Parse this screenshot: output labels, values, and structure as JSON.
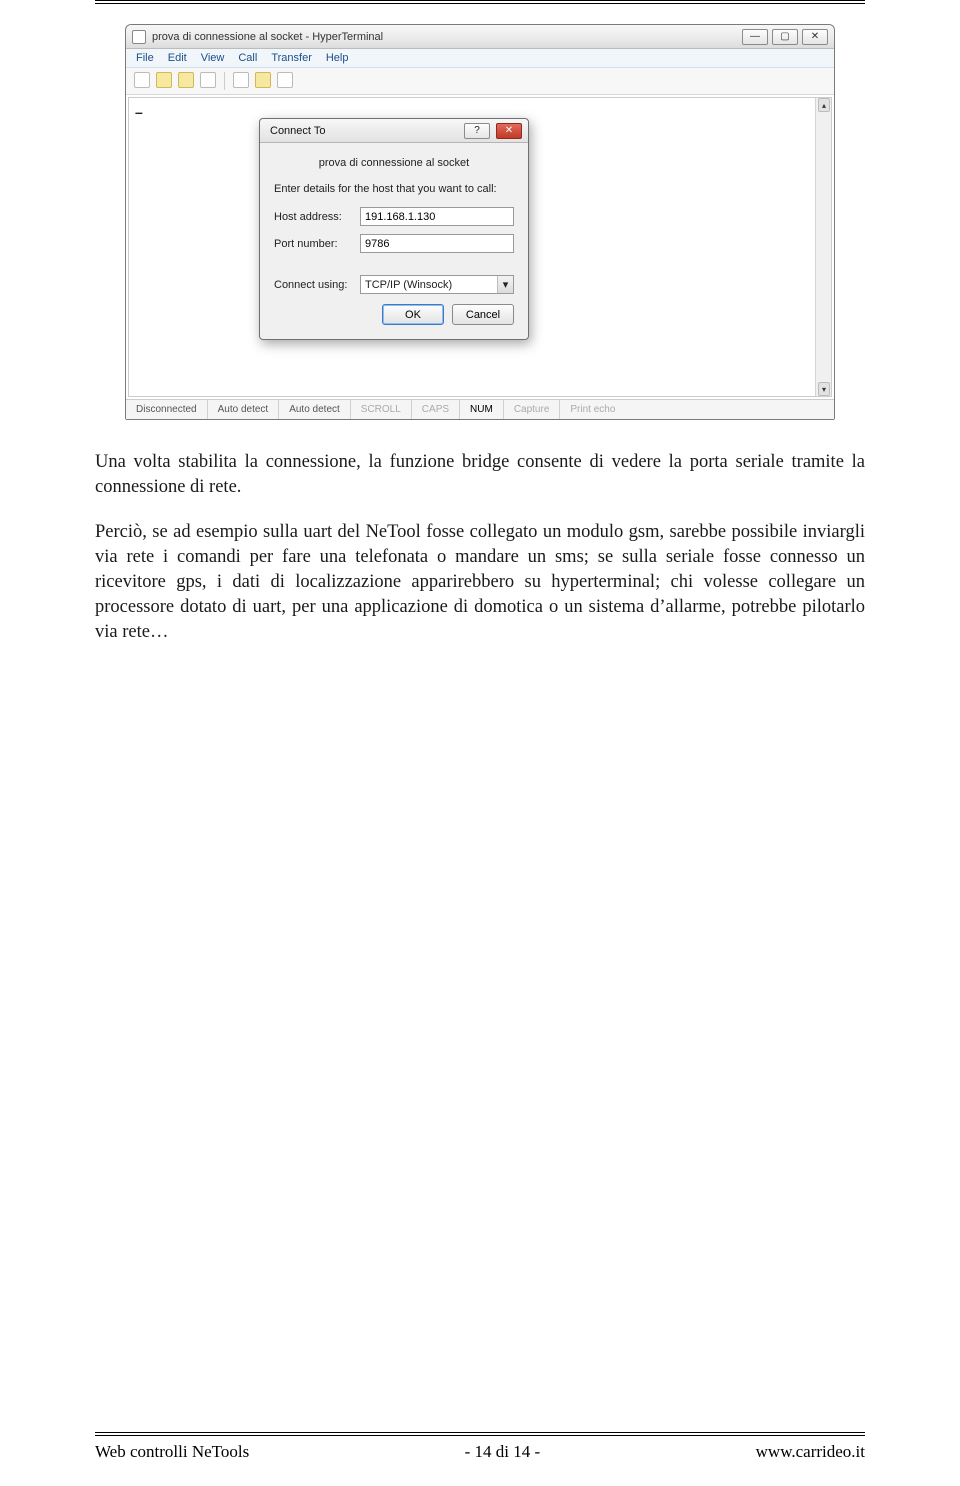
{
  "window": {
    "title": "prova di connessione al socket - HyperTerminal",
    "menu": [
      "File",
      "Edit",
      "View",
      "Call",
      "Transfer",
      "Help"
    ],
    "statusbar": {
      "conn": "Disconnected",
      "det1": "Auto detect",
      "det2": "Auto detect",
      "scroll": "SCROLL",
      "caps": "CAPS",
      "num": "NUM",
      "capture": "Capture",
      "echo": "Print echo"
    },
    "terminal_char": "–"
  },
  "dialog": {
    "title": "Connect To",
    "device": "prova di connessione al socket",
    "prompt": "Enter details for the host that you want to call:",
    "labels": {
      "host": "Host address:",
      "port": "Port number:",
      "using": "Connect using:"
    },
    "host": "191.168.1.130",
    "port": "9786",
    "using": "TCP/IP (Winsock)",
    "ok": "OK",
    "cancel": "Cancel",
    "help_q": "?"
  },
  "paragraphs": {
    "p1": "Una volta stabilita la connessione, la funzione bridge consente di vedere la porta seriale tramite la connessione di rete.",
    "p2": "Perciò, se ad esempio sulla uart del NeTool fosse collegato un modulo gsm, sarebbe possibile inviargli via rete i comandi per fare una telefonata o mandare un sms; se sulla seriale fosse connesso un ricevitore gps, i dati di localizzazione apparirebbero su hyperterminal; chi volesse collegare un processore dotato di uart, per una applicazione di domotica o un sistema d’allarme, potrebbe pilotarlo via rete…"
  },
  "footer": {
    "left": "Web controlli NeTools",
    "center": "- 14 di 14 -",
    "right": "www.carrideo.it"
  }
}
